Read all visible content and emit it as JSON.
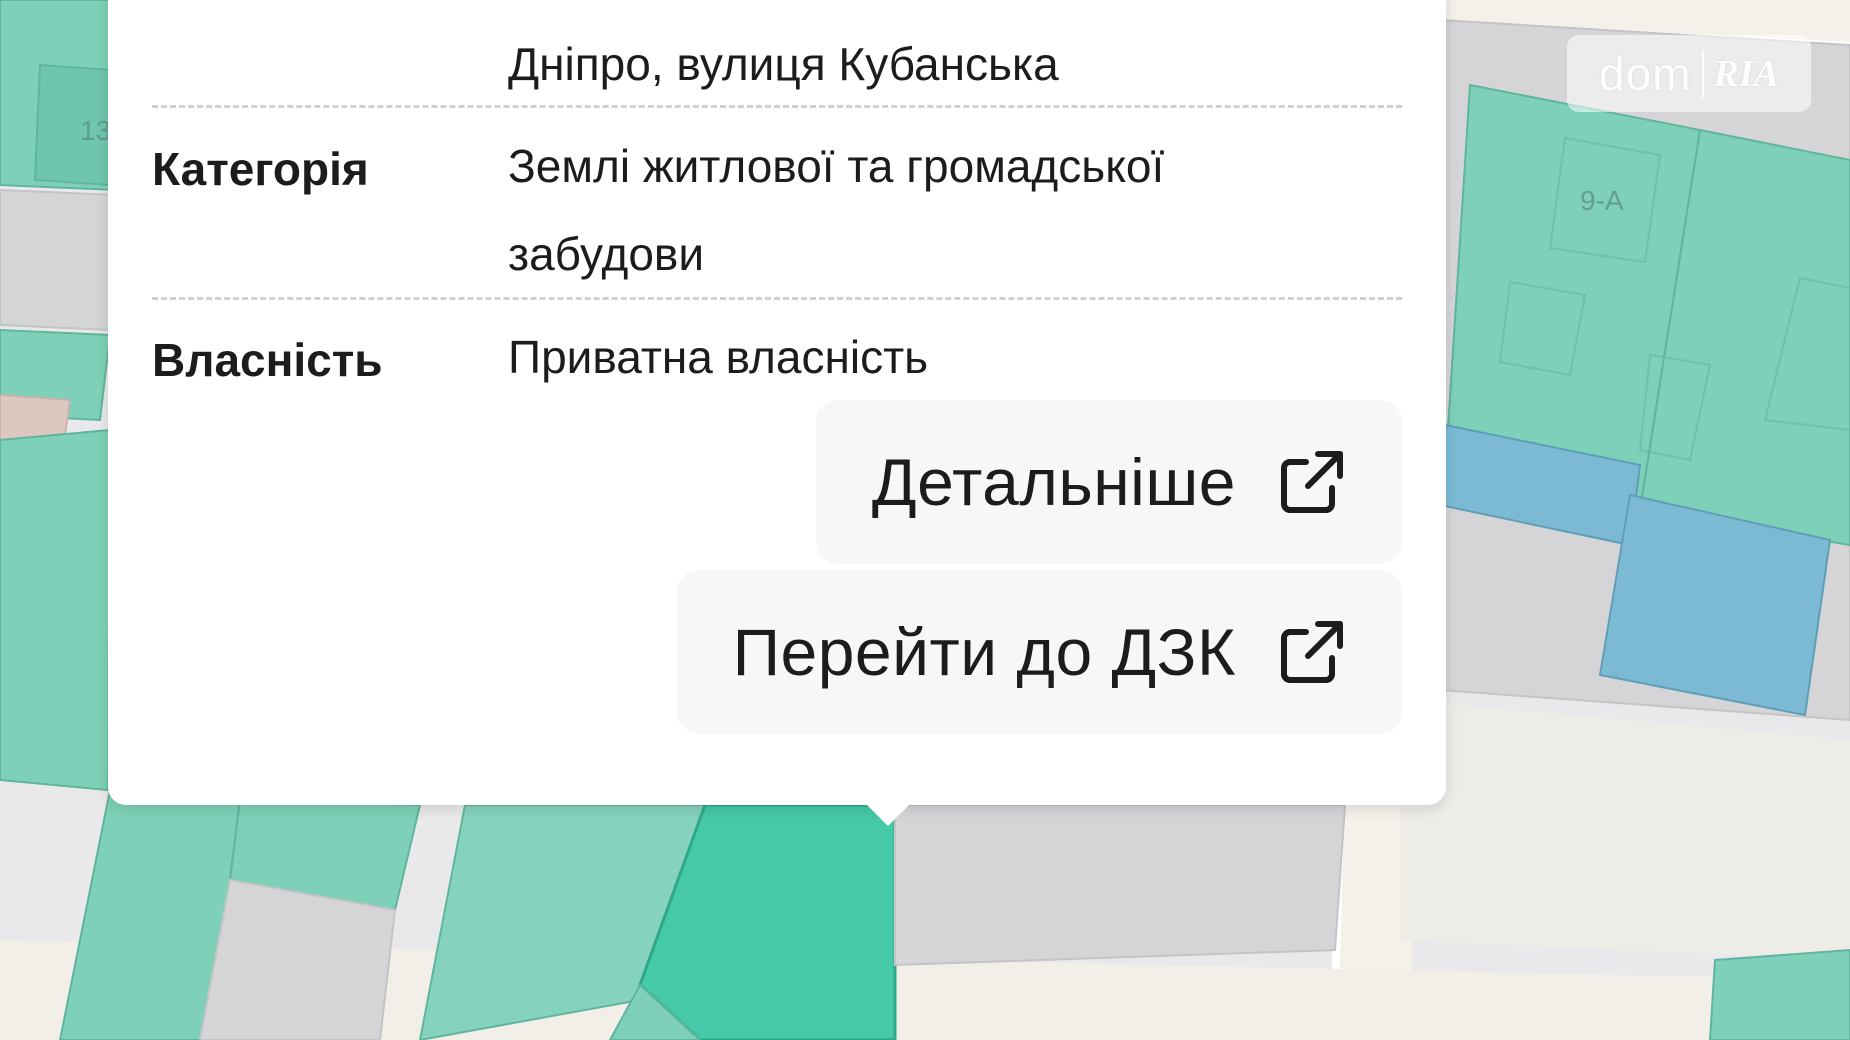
{
  "popup": {
    "rows": [
      {
        "label": "",
        "value": "Дніпро, вулиця Кубанська"
      },
      {
        "label": "Категорія",
        "value": "Землі житлової та громадської забудови"
      },
      {
        "label": "Власність",
        "value": "Приватна власність"
      }
    ],
    "buttons": [
      {
        "label": "Детальніше",
        "icon": "external-link-icon"
      },
      {
        "label": "Перейти до ДЗК",
        "icon": "external-link-icon"
      }
    ]
  },
  "map": {
    "plot_labels": [
      "13",
      "9-А"
    ],
    "colors": {
      "background": "#e9e9eb",
      "road": "#f2efe8",
      "plot_green": "#7ed1b8",
      "plot_green_selected": "#45c9a8",
      "plot_blue": "#7cbad3",
      "plot_gray": "#d5d5d8",
      "plot_pink": "#dcc8c0"
    }
  },
  "watermark": {
    "brand_left": "dom",
    "brand_right": "RIA"
  }
}
